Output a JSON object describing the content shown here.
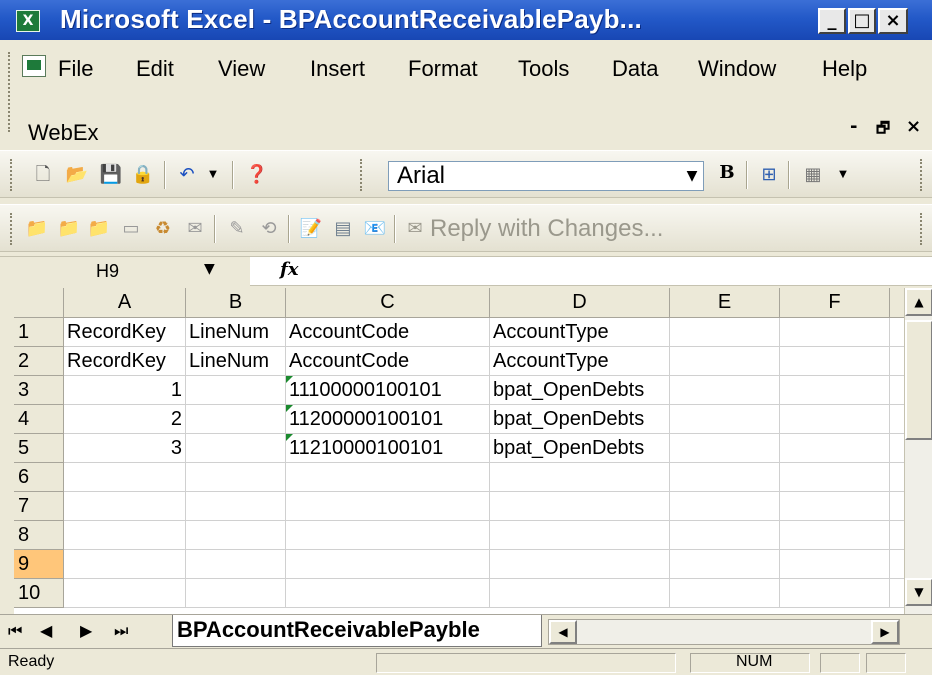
{
  "window": {
    "title": "Microsoft Excel - BPAccountReceivablePayb...",
    "minimize": "_",
    "maximize": "□",
    "close": "×"
  },
  "menu": {
    "items": [
      "File",
      "Edit",
      "View",
      "Insert",
      "Format",
      "Tools",
      "Data",
      "Window",
      "Help"
    ],
    "webex": "WebEx",
    "doc_min": "-",
    "doc_restore": "🗗",
    "doc_close": "×"
  },
  "toolbar": {
    "font_name": "Arial",
    "bold_label": "B",
    "reply_with_changes": "Reply with Changes..."
  },
  "formula_bar": {
    "name_box": "H9",
    "fx": "fx",
    "formula": ""
  },
  "grid": {
    "columns": [
      "A",
      "B",
      "C",
      "D",
      "E",
      "F"
    ],
    "rows": [
      {
        "num": "1",
        "cells": [
          "RecordKey",
          "LineNum",
          "AccountCode",
          "AccountType",
          "",
          ""
        ]
      },
      {
        "num": "2",
        "cells": [
          "RecordKey",
          "LineNum",
          "AccountCode",
          "AccountType",
          "",
          ""
        ]
      },
      {
        "num": "3",
        "cells": [
          "1",
          "",
          "11100000100101",
          "bpat_OpenDebts",
          "",
          ""
        ]
      },
      {
        "num": "4",
        "cells": [
          "2",
          "",
          "11200000100101",
          "bpat_OpenDebts",
          "",
          ""
        ]
      },
      {
        "num": "5",
        "cells": [
          "3",
          "",
          "11210000100101",
          "bpat_OpenDebts",
          "",
          ""
        ]
      },
      {
        "num": "6",
        "cells": [
          "",
          "",
          "",
          "",
          "",
          ""
        ]
      },
      {
        "num": "7",
        "cells": [
          "",
          "",
          "",
          "",
          "",
          ""
        ]
      },
      {
        "num": "8",
        "cells": [
          "",
          "",
          "",
          "",
          "",
          ""
        ]
      },
      {
        "num": "9",
        "cells": [
          "",
          "",
          "",
          "",
          "",
          ""
        ]
      },
      {
        "num": "10",
        "cells": [
          "",
          "",
          "",
          "",
          "",
          ""
        ]
      }
    ],
    "selected_row": "9"
  },
  "sheets": {
    "active": "BPAccountReceivablePayble"
  },
  "status": {
    "ready": "Ready",
    "num": "NUM"
  },
  "colors": {
    "title_bar": "#2359c8",
    "selected_header": "#ffc67a",
    "number_text_marker": "#1b8a2e"
  }
}
